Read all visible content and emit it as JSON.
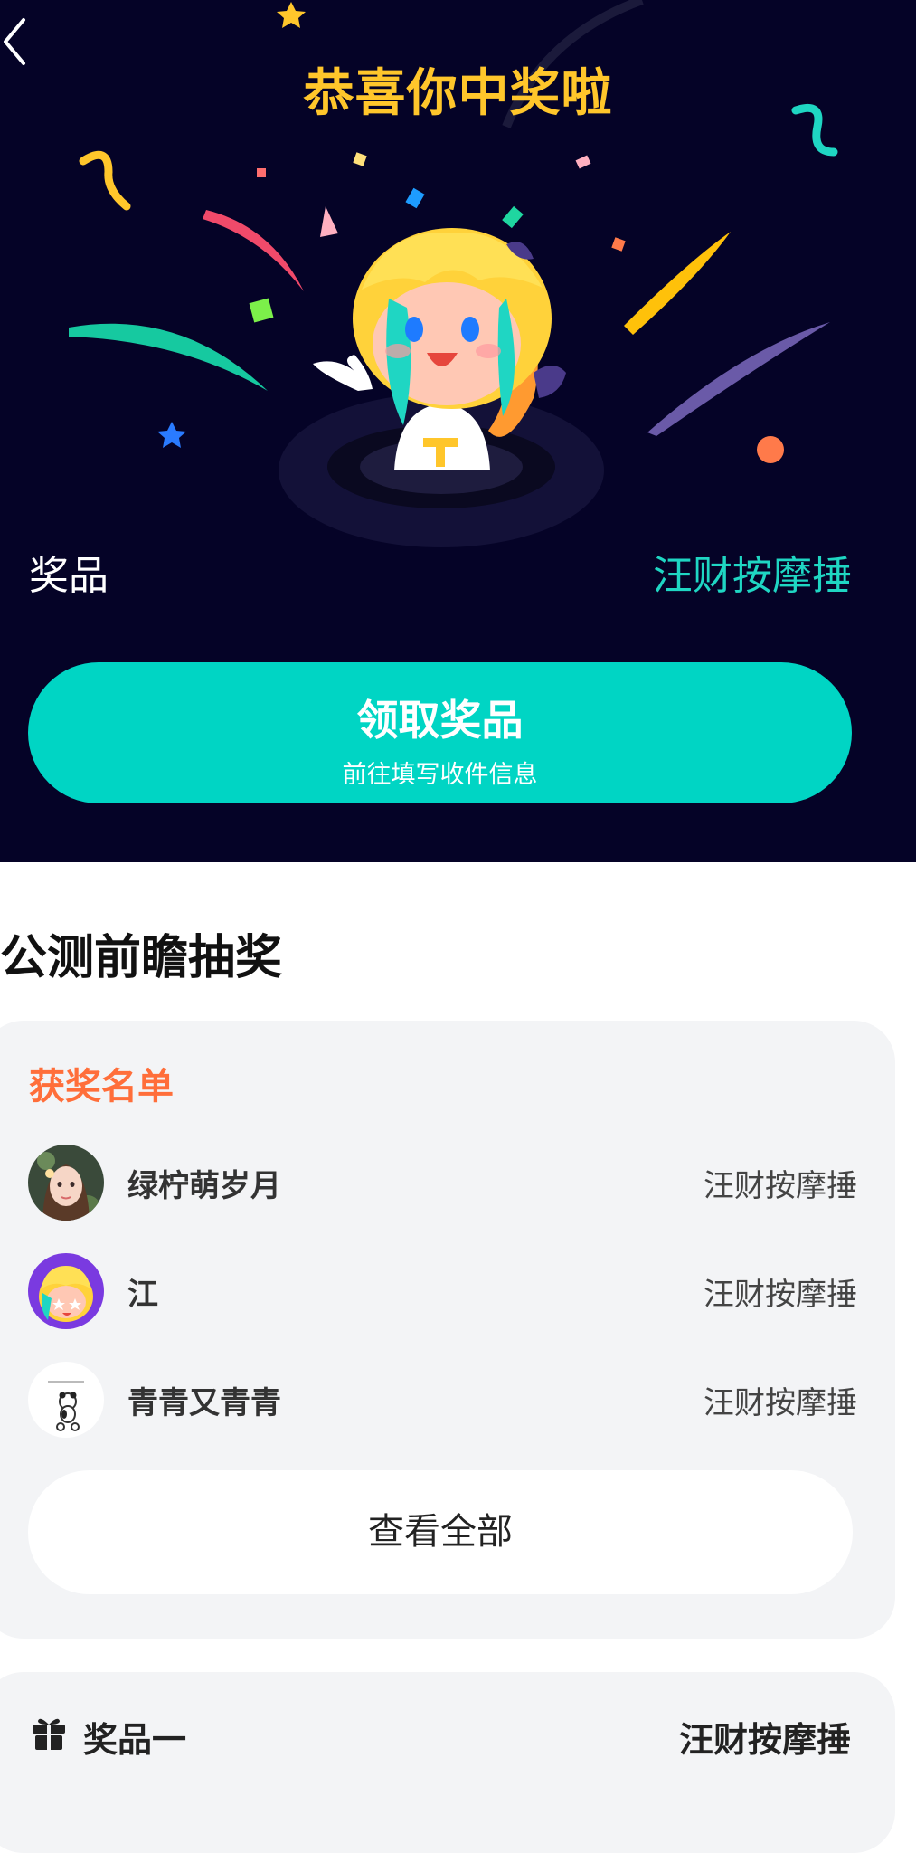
{
  "hero": {
    "title": "恭喜你中奖啦",
    "prize_label": "奖品",
    "prize_value": "汪财按摩捶",
    "claim_button": {
      "label": "领取奖品",
      "sublabel": "前往填写收件信息"
    }
  },
  "section": {
    "title": "公测前瞻抽奖"
  },
  "winners": {
    "heading": "获奖名单",
    "items": [
      {
        "name": "绿柠萌岁月",
        "prize": "汪财按摩捶",
        "avatar": "girl-portrait-avatar"
      },
      {
        "name": "江",
        "prize": "汪财按摩捶",
        "avatar": "anime-mascot-avatar"
      },
      {
        "name": "青青又青青",
        "prize": "汪财按摩捶",
        "avatar": "panda-sketch-avatar"
      }
    ],
    "view_all_label": "查看全部"
  },
  "prize_list": {
    "item_label": "奖品一",
    "item_value": "汪财按摩捶"
  },
  "colors": {
    "hero_bg": "#050327",
    "title_gold": "#ffc62b",
    "accent_teal": "#00d5c4",
    "winners_orange": "#ff6e3a",
    "card_bg": "#f3f4f6"
  },
  "icons": [
    "back-arrow-icon",
    "gift-icon"
  ]
}
